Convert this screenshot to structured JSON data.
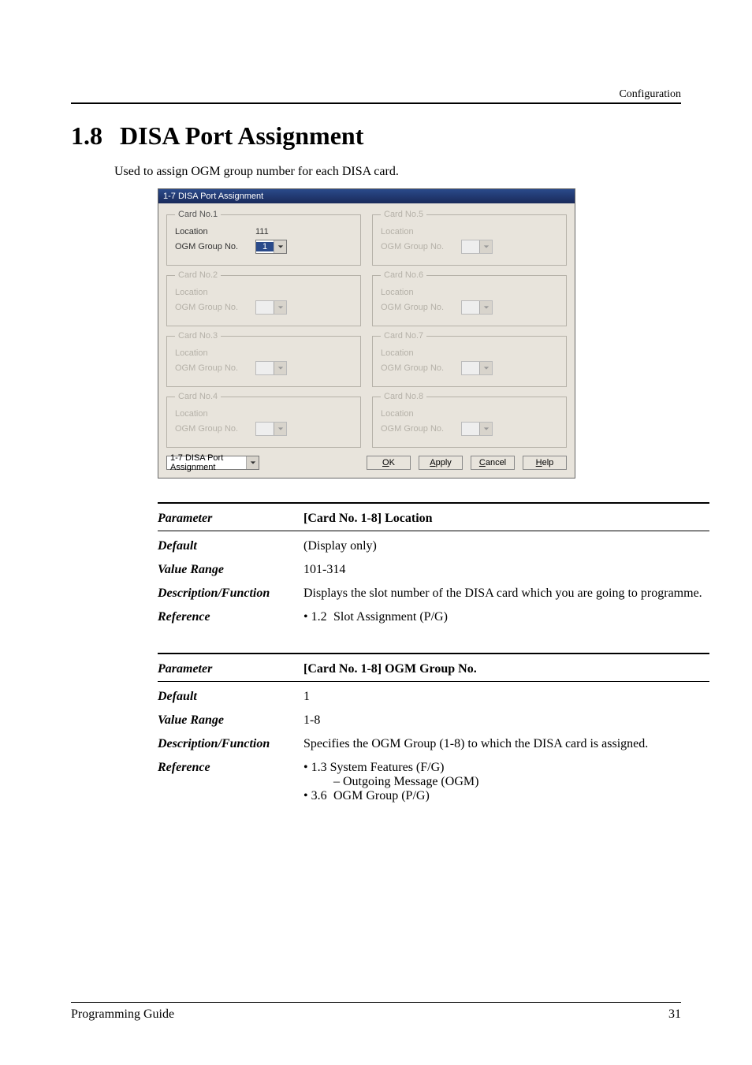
{
  "header": {
    "category": "Configuration"
  },
  "section": {
    "number": "1.8",
    "title": "DISA Port Assignment"
  },
  "lead": "Used to assign OGM group number for each DISA card.",
  "dialog": {
    "title": "1-7 DISA Port Assignment",
    "footer_select": "1-7 DISA Port Assignment",
    "label_location": "Location",
    "label_ogm": "OGM Group No.",
    "cards": [
      {
        "legend": "Card No.1",
        "location": "111",
        "ogm": "1",
        "active": true
      },
      {
        "legend": "Card No.2",
        "location": "",
        "ogm": "",
        "active": false
      },
      {
        "legend": "Card No.3",
        "location": "",
        "ogm": "",
        "active": false
      },
      {
        "legend": "Card No.4",
        "location": "",
        "ogm": "",
        "active": false
      },
      {
        "legend": "Card No.5",
        "location": "",
        "ogm": "",
        "active": false
      },
      {
        "legend": "Card No.6",
        "location": "",
        "ogm": "",
        "active": false
      },
      {
        "legend": "Card No.7",
        "location": "",
        "ogm": "",
        "active": false
      },
      {
        "legend": "Card No.8",
        "location": "",
        "ogm": "",
        "active": false
      }
    ],
    "buttons": {
      "ok": "OK",
      "apply": "Apply",
      "cancel": "Cancel",
      "help": "Help"
    }
  },
  "tables": [
    {
      "rows": {
        "param_label": "Parameter",
        "param_value": "[Card No. 1-8] Location",
        "default_label": "Default",
        "default_value": "(Display only)",
        "range_label": "Value Range",
        "range_value": "101-314",
        "desc_label": "Description/Function",
        "desc_value": "Displays the slot number of the DISA card which you are going to programme.",
        "ref_label": "Reference",
        "ref_bullet": "• 1.2",
        "ref_text": "Slot Assignment (P/G)"
      }
    },
    {
      "rows": {
        "param_label": "Parameter",
        "param_value": "[Card No. 1-8] OGM Group No.",
        "default_label": "Default",
        "default_value": "1",
        "range_label": "Value Range",
        "range_value": "1-8",
        "desc_label": "Description/Function",
        "desc_value": "Specifies the OGM Group (1-8) to which the DISA card is assigned.",
        "ref_label": "Reference",
        "ref_line1": "• 1.3 System Features (F/G)",
        "ref_line2": "– Outgoing Message (OGM)",
        "ref_bullet2": "• 3.6",
        "ref_text2": "OGM Group (P/G)"
      }
    }
  ],
  "footer": {
    "left": "Programming Guide",
    "right": "31"
  }
}
